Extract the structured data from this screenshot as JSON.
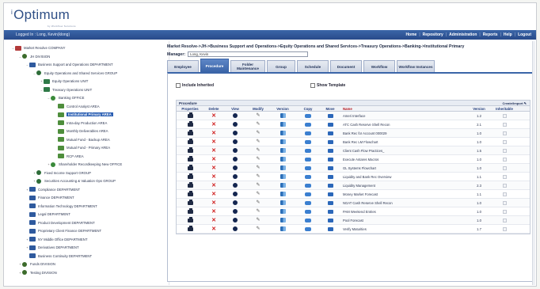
{
  "header": {
    "logo_text": "Optimum",
    "logo_prefix": "i",
    "logo_tag": "by Workflow Solutions"
  },
  "topbar": {
    "user": "Logged In : Long, Kevin(klong)",
    "nav": [
      "Home",
      "Repository",
      "Administration",
      "Reports",
      "Help",
      "Logout"
    ]
  },
  "tree": [
    {
      "label": "Market Resolve COMPANY",
      "type": "company",
      "level": 0,
      "toggle": "–"
    },
    {
      "label": "JH DIVISION",
      "type": "division",
      "level": 1,
      "toggle": "–"
    },
    {
      "label": "Business Support and Operations DEPARTMENT",
      "type": "dept",
      "level": 2,
      "toggle": "–"
    },
    {
      "label": "Equity Operations and Shared Services GROUP",
      "type": "group",
      "level": 3,
      "toggle": "–"
    },
    {
      "label": "Equity Operations UNIT",
      "type": "unit",
      "level": 4,
      "toggle": "+"
    },
    {
      "label": "Treasury Operations UNIT",
      "type": "unit",
      "level": 4,
      "toggle": "–"
    },
    {
      "label": "Banking OFFICE",
      "type": "office",
      "level": 5,
      "toggle": "–"
    },
    {
      "label": "Control Analyst AREA",
      "type": "area",
      "level": 6,
      "toggle": ""
    },
    {
      "label": "Institutional Primary AREA",
      "type": "area",
      "level": 6,
      "toggle": "",
      "selected": true
    },
    {
      "label": "Intra-day Production AREA",
      "type": "area",
      "level": 6,
      "toggle": ""
    },
    {
      "label": "Monthly Deliverables AREA",
      "type": "area",
      "level": 6,
      "toggle": ""
    },
    {
      "label": "Mutual Fund - Backup AREA",
      "type": "area",
      "level": 6,
      "toggle": ""
    },
    {
      "label": "Mutual Fund - Primary AREA",
      "type": "area",
      "level": 6,
      "toggle": ""
    },
    {
      "label": "RCP AREA",
      "type": "area",
      "level": 6,
      "toggle": ""
    },
    {
      "label": "Shareholder Recordkeeping New OFFICE",
      "type": "office",
      "level": 5,
      "toggle": "+"
    },
    {
      "label": "Fixed Income Support GROUP",
      "type": "group",
      "level": 3,
      "toggle": "+"
    },
    {
      "label": "Securities Accounting & Valuation Ops GROUP",
      "type": "group",
      "level": 3,
      "toggle": "+"
    },
    {
      "label": "Compliance DEPARTMENT",
      "type": "dept",
      "level": 2,
      "toggle": "+"
    },
    {
      "label": "Finance DEPARTMENT",
      "type": "dept",
      "level": 2,
      "toggle": ""
    },
    {
      "label": "Information Technology DEPARTMENT",
      "type": "dept",
      "level": 2,
      "toggle": ""
    },
    {
      "label": "Legal DEPARTMENT",
      "type": "dept",
      "level": 2,
      "toggle": ""
    },
    {
      "label": "Product Development DEPARTMENT",
      "type": "dept",
      "level": 2,
      "toggle": ""
    },
    {
      "label": "Proprietary Client Finance DEPARTMENT",
      "type": "dept",
      "level": 2,
      "toggle": ""
    },
    {
      "label": "NY Middle Office DEPARTMENT",
      "type": "dept",
      "level": 2,
      "toggle": "+"
    },
    {
      "label": "Derivatives DEPARTMENT",
      "type": "dept",
      "level": 2,
      "toggle": "+"
    },
    {
      "label": "Business Continuity DEPARTMENT",
      "type": "dept",
      "level": 2,
      "toggle": ""
    },
    {
      "label": "Funds DIVISION",
      "type": "division",
      "level": 1,
      "toggle": "+"
    },
    {
      "label": "Testing DIVISION",
      "type": "division",
      "level": 1,
      "toggle": "+"
    }
  ],
  "main": {
    "breadcrumb": "Market Resolve->JH->Business Support and Operations->Equity Operations and Shared Services->Treasury Operations->Banking->Institutional Primary",
    "manager_label": "Manager:",
    "manager_value": "Long, Kevin",
    "tabs": [
      {
        "label": "Employee",
        "active": false
      },
      {
        "label": "Procedure",
        "active": true
      },
      {
        "label": "Folder Maintenance",
        "active": false
      },
      {
        "label": "Group",
        "active": false
      },
      {
        "label": "Schedule",
        "active": false
      },
      {
        "label": "Document",
        "active": false
      },
      {
        "label": "Workflow",
        "active": false
      },
      {
        "label": "Workflow Instances",
        "active": false
      }
    ],
    "include_inherited": "Include Inherited",
    "show_template": "Show Template",
    "grid_caption": "Procedure",
    "create_import": "Create/Import",
    "columns": [
      "Properties",
      "Delete",
      "View",
      "Modify",
      "Version",
      "Copy",
      "Move",
      "Name",
      "Version",
      "Inheritable"
    ],
    "rows": [
      {
        "name": "Ameri Interface",
        "version": "1.2"
      },
      {
        "name": "ATC Cash Reserve Shell Recon",
        "version": "2.1"
      },
      {
        "name": "Bank Rec for Account 000029",
        "version": "1.0"
      },
      {
        "name": "Bank Rec LM Flowchart",
        "version": "1.0"
      },
      {
        "name": "Client Cash Flow Practices_",
        "version": "1.5"
      },
      {
        "name": "Execute Antares Macros",
        "version": "1.0"
      },
      {
        "name": "GL Systems Flowchart",
        "version": "1.0"
      },
      {
        "name": "Liquidity and Bank Rec Overview",
        "version": "1.1"
      },
      {
        "name": "Liquidity Management",
        "version": "2.3"
      },
      {
        "name": "Money Market Forecast",
        "version": "1.1"
      },
      {
        "name": "NGAT Cash Reserve Shell Recon",
        "version": "1.0"
      },
      {
        "name": "PAM Weekend Entries",
        "version": "1.0"
      },
      {
        "name": "Pool Forecast",
        "version": "1.0"
      },
      {
        "name": "Verify Maturities",
        "version": "1.7"
      }
    ]
  }
}
